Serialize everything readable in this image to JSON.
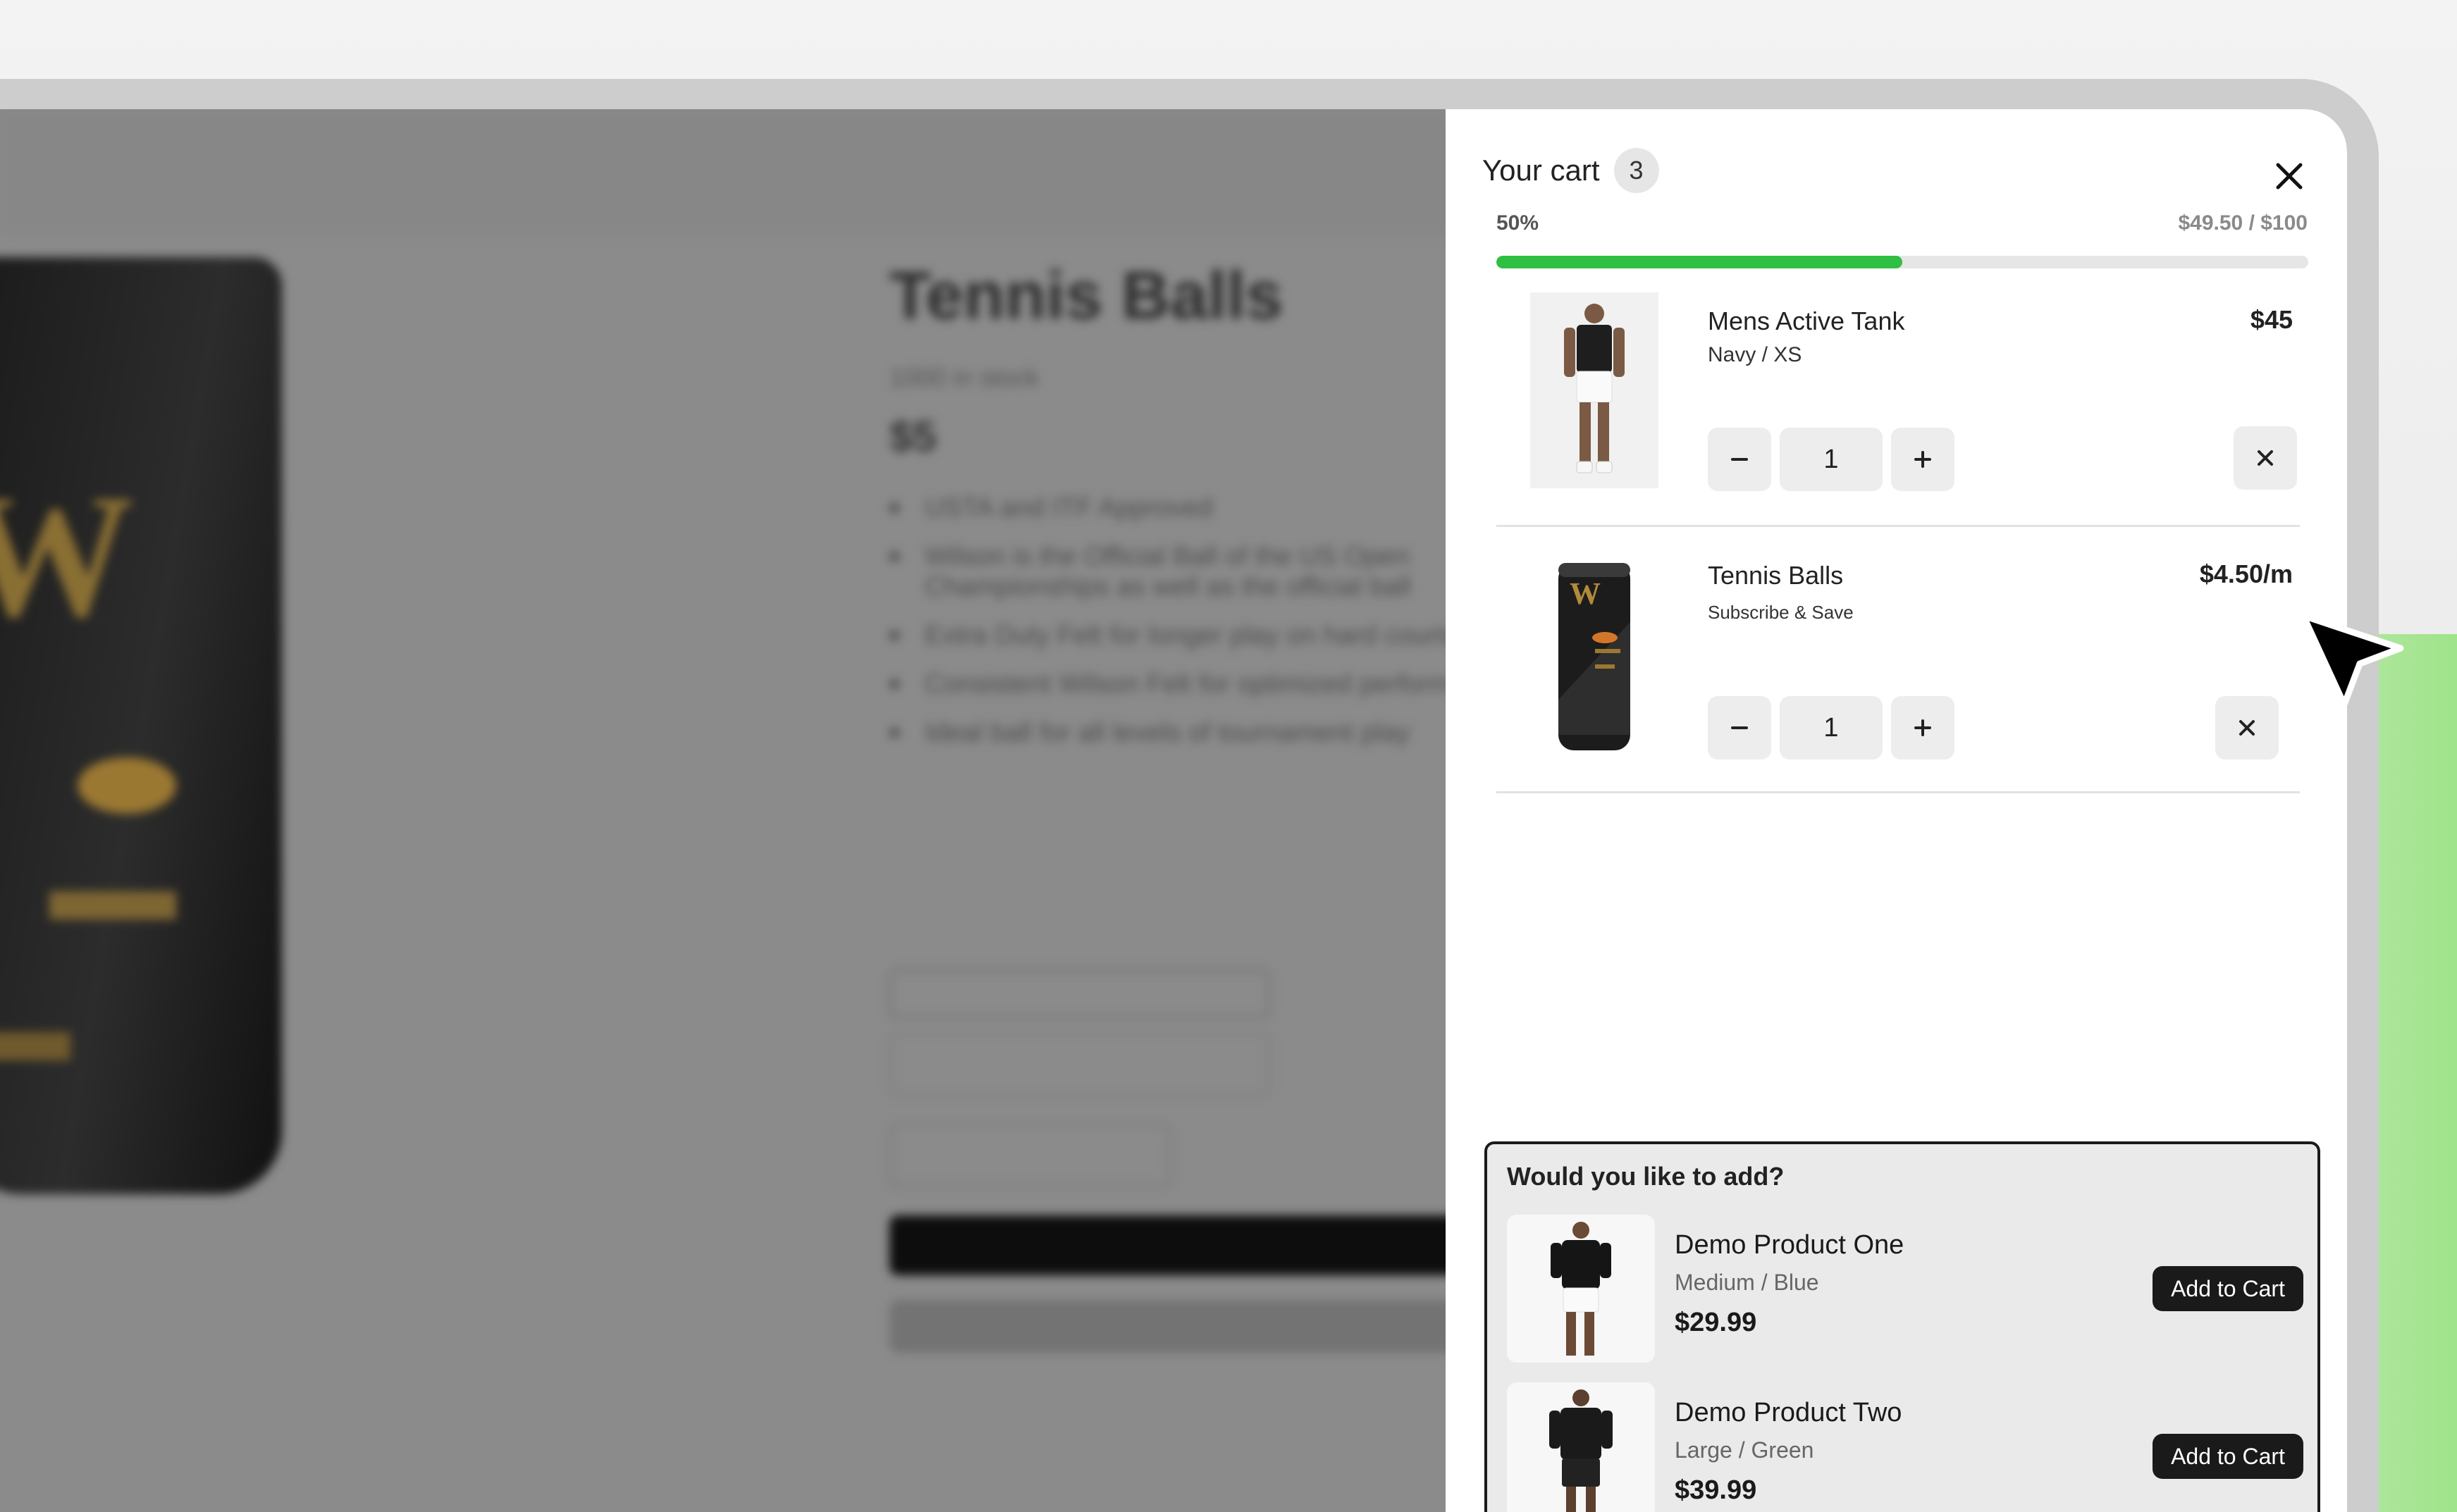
{
  "background_page": {
    "product_title": "Tennis Balls",
    "stock": "1000 in stock",
    "price": "$5",
    "bullets": [
      "USTA and ITF Approved",
      "Wilson is the Official Ball of the US Open Championships as well as the official ball",
      "Extra Duty Felt for longer play on hard courts",
      "Consistent Wilson Felt for optimized performance",
      "Ideal ball for all levels of tournament play"
    ],
    "can_logo": "W"
  },
  "cart": {
    "title": "Your cart",
    "count": "3",
    "progress": {
      "percent_label": "50%",
      "amount_label": "$49.50 / $100",
      "fill_fraction": 0.5,
      "color": "#2fbf43"
    },
    "items": [
      {
        "name": "Mens Active Tank",
        "variant": "Navy / XS",
        "price": "$45",
        "quantity": "1"
      },
      {
        "name": "Tennis Balls",
        "variant": "Subscribe & Save",
        "price": "$4.50/m",
        "quantity": "1"
      }
    ],
    "icons": {
      "close": "close-icon",
      "minus": "minus-icon",
      "plus": "plus-icon",
      "remove": "remove-icon"
    }
  },
  "upsell": {
    "title": "Would you like to add?",
    "items": [
      {
        "name": "Demo Product One",
        "variant": "Medium / Blue",
        "price": "$29.99",
        "button": "Add to Cart"
      },
      {
        "name": "Demo Product Two",
        "variant": "Large / Green",
        "price": "$39.99",
        "button": "Add to Cart"
      }
    ]
  },
  "cursor": "pointer-cursor-icon"
}
